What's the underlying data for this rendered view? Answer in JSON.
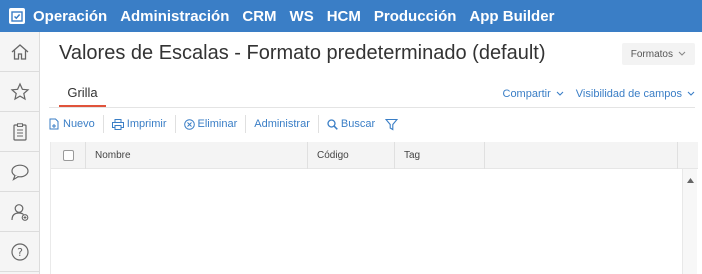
{
  "nav": {
    "items": [
      "Operación",
      "Administración",
      "CRM",
      "WS",
      "HCM",
      "Producción",
      "App Builder"
    ]
  },
  "sidebar": {
    "icons": [
      "home-icon",
      "star-icon",
      "clipboard-icon",
      "chat-icon",
      "user-add-icon",
      "help-icon"
    ]
  },
  "page": {
    "title": "Valores de Escalas - Formato predeterminado (default)",
    "formats_label": "Formatos"
  },
  "tabs": {
    "grid_label": "Grilla"
  },
  "links": {
    "share": "Compartir",
    "visibility": "Visibilidad de campos"
  },
  "toolbar": {
    "new": "Nuevo",
    "print": "Imprimir",
    "delete": "Eliminar",
    "admin": "Administrar",
    "search": "Buscar"
  },
  "grid": {
    "columns": [
      "Nombre",
      "Código",
      "Tag"
    ]
  },
  "colors": {
    "nav_bg": "#3a7ec6",
    "accent": "#e0533b",
    "link": "#3a7ec6"
  }
}
